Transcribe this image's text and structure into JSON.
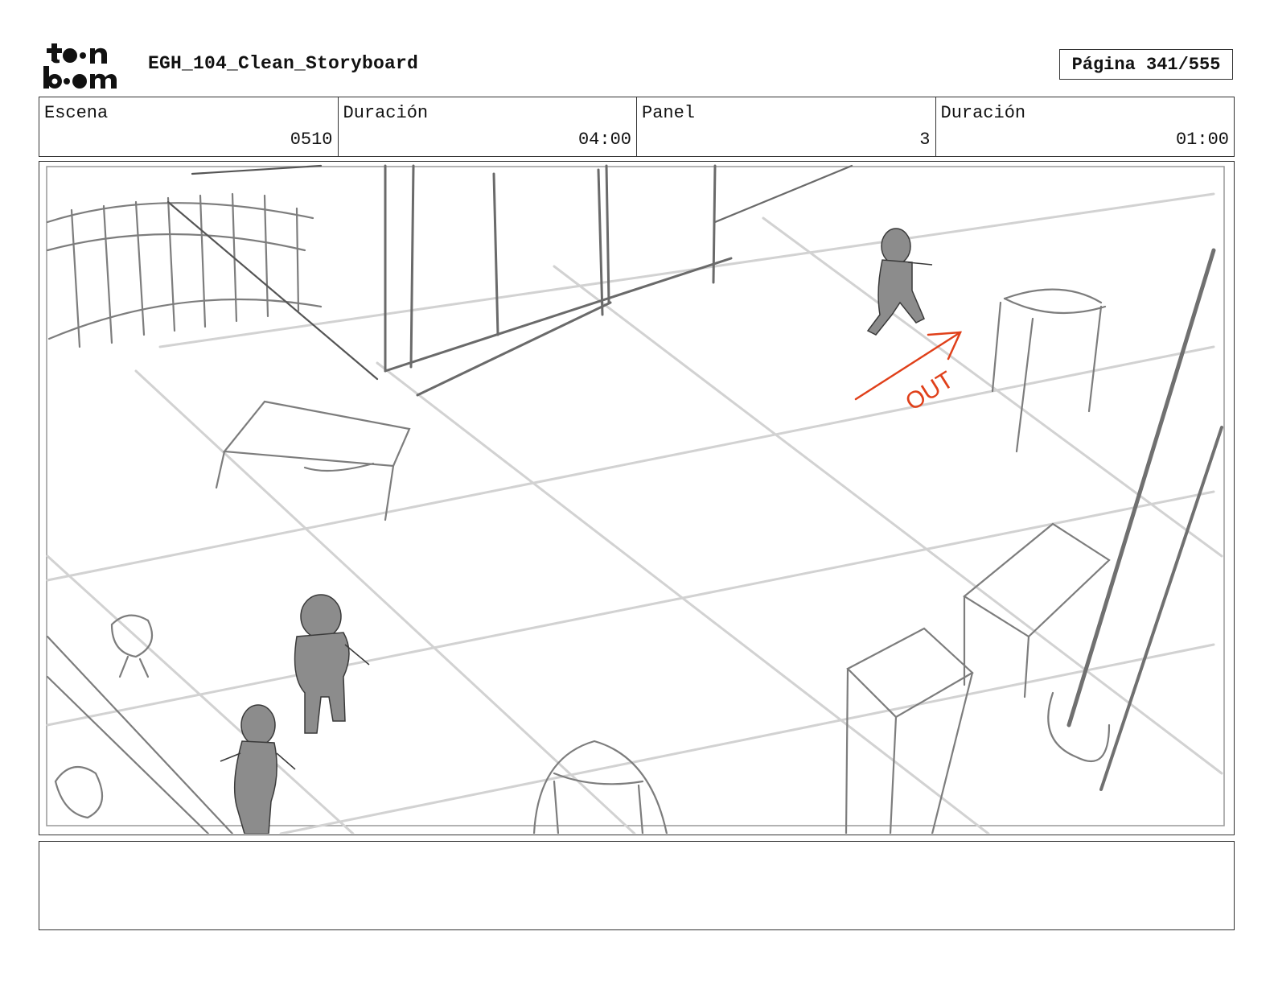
{
  "header": {
    "logo_text": "toon boom",
    "title": "EGH_104_Clean_Storyboard",
    "page": "Página 341/555"
  },
  "info": {
    "scene_label": "Escena",
    "scene_value": "0510",
    "scene_duration_label": "Duración",
    "scene_duration_value": "04:00",
    "panel_label": "Panel",
    "panel_value": "3",
    "panel_duration_label": "Duración",
    "panel_duration_value": "01:00"
  },
  "panel_art": {
    "annotation": "OUT",
    "annotation_color": "#e0401a",
    "line_color": "#8a8a8a",
    "figure_color": "#8c8c8c"
  },
  "notes": {
    "text": ""
  }
}
